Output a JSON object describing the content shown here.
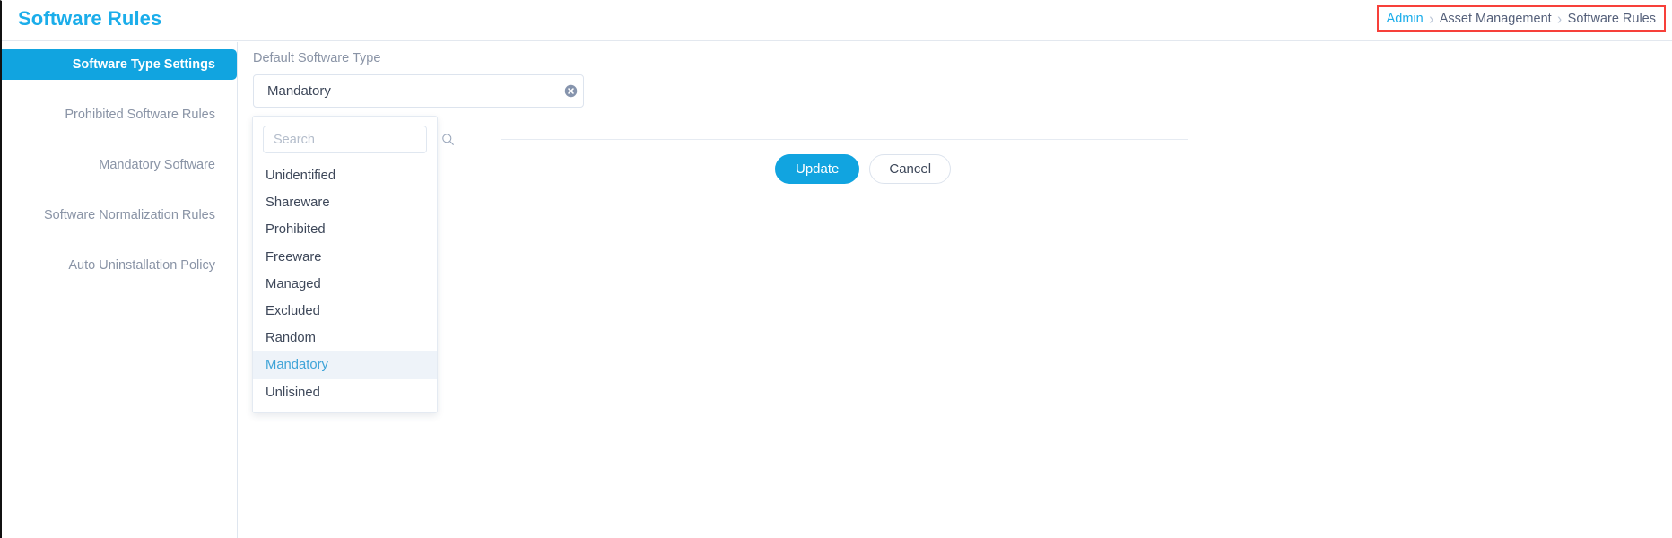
{
  "header": {
    "title": "Software Rules"
  },
  "breadcrumb": {
    "separator": "›",
    "items": [
      {
        "label": "Admin",
        "is_link": true
      },
      {
        "label": "Asset Management",
        "is_link": false
      },
      {
        "label": "Software Rules",
        "is_link": false
      }
    ],
    "highlight_color": "#f7403a"
  },
  "sidebar": {
    "items": [
      {
        "label": "Software Type Settings",
        "active": true
      },
      {
        "label": "Prohibited Software Rules",
        "active": false
      },
      {
        "label": "Mandatory Software",
        "active": false
      },
      {
        "label": "Software Normalization Rules",
        "active": false
      },
      {
        "label": "Auto Uninstallation Policy",
        "active": false
      }
    ],
    "active_color": "#11a4e0"
  },
  "main": {
    "field_label": "Default Software Type",
    "select_value": "Mandatory",
    "clear_icon": "clear-circle-icon",
    "buttons": {
      "update": "Update",
      "cancel": "Cancel"
    },
    "accent_color": "#11a4e0"
  },
  "dropdown": {
    "search_placeholder": "Search",
    "search_value": "",
    "search_icon": "magnifier-icon",
    "options": [
      {
        "label": "Unidentified",
        "selected": false
      },
      {
        "label": "Shareware",
        "selected": false
      },
      {
        "label": "Prohibited",
        "selected": false
      },
      {
        "label": "Freeware",
        "selected": false
      },
      {
        "label": "Managed",
        "selected": false
      },
      {
        "label": "Excluded",
        "selected": false
      },
      {
        "label": "Random",
        "selected": false
      },
      {
        "label": "Mandatory",
        "selected": true
      },
      {
        "label": "Unlisined",
        "selected": false
      }
    ],
    "selected_bg": "#eef3f9",
    "selected_text": "#3fa4d8"
  }
}
